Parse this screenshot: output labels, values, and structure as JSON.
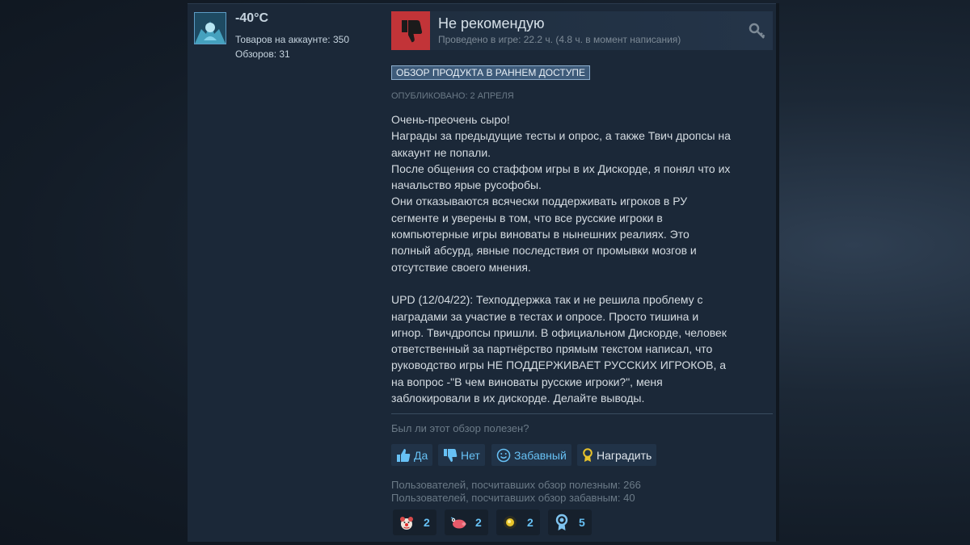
{
  "author": {
    "name": "-40°C",
    "products_line": "Товаров на аккаунте: 350",
    "reviews_line": "Обзоров: 31"
  },
  "review": {
    "verdict": "Не рекомендую",
    "playtime": "Проведено в игре: 22.2 ч. (4.8 ч. в момент написания)",
    "badge": "ОБЗОР ПРОДУКТА В РАННЕМ ДОСТУПЕ",
    "posted": "ОПУБЛИКОВАНО: 2 АПРЕЛЯ",
    "lines": [
      "Очень-преочень сыро!",
      "Награды за предыдущие тесты и опрос, а также Твич дропсы на",
      "аккаунт не попали.",
      "После общения со стаффом игры в их Дискорде, я понял что их",
      "начальство ярые русофобы.",
      "Они отказываются всячески поддерживать игроков в РУ",
      "сегменте и уверены в том, что все русские игроки в",
      "компьютерные игры виноваты в нынешних реалиях. Это",
      "полный абсурд, явные последствия от промывки мозгов и",
      "отсутствие своего мнения.",
      "",
      "UPD (12/04/22): Техподдержка так и не решила проблему с",
      "наградами за участие в тестах и опросе. Просто тишина и",
      "игнор. Твичдропсы пришли. В официальном Дискорде, человек",
      "ответственный за партнёрство прямым текстом написал, что",
      "руководство игры НЕ ПОДДЕРЖИВАЕТ РУССКИХ ИГРОКОВ, а",
      "на вопрос -\"В чем виноваты русские игроки?\", меня",
      "заблокировали в их дискорде. Делайте выводы."
    ]
  },
  "feedback": {
    "question": "Был ли этот обзор полезен?",
    "yes": "Да",
    "no": "Нет",
    "funny": "Забавный",
    "award": "Наградить",
    "helpful_count": "Пользователей, посчитавших обзор полезным: 266",
    "funny_count": "Пользователей, посчитавших обзор забавным: 40"
  },
  "awards": [
    {
      "icon": "clown-face-icon",
      "count": "2"
    },
    {
      "icon": "pig-face-icon",
      "count": "2"
    },
    {
      "icon": "golden-orb-icon",
      "count": "2"
    },
    {
      "icon": "ribbon-medal-icon",
      "count": "5"
    }
  ],
  "colors": {
    "page_bg": "#1b2838",
    "thumbs_down_bg": "#c23438",
    "link_blue": "#67c1f5",
    "badge_bg": "#3e5b7a"
  }
}
